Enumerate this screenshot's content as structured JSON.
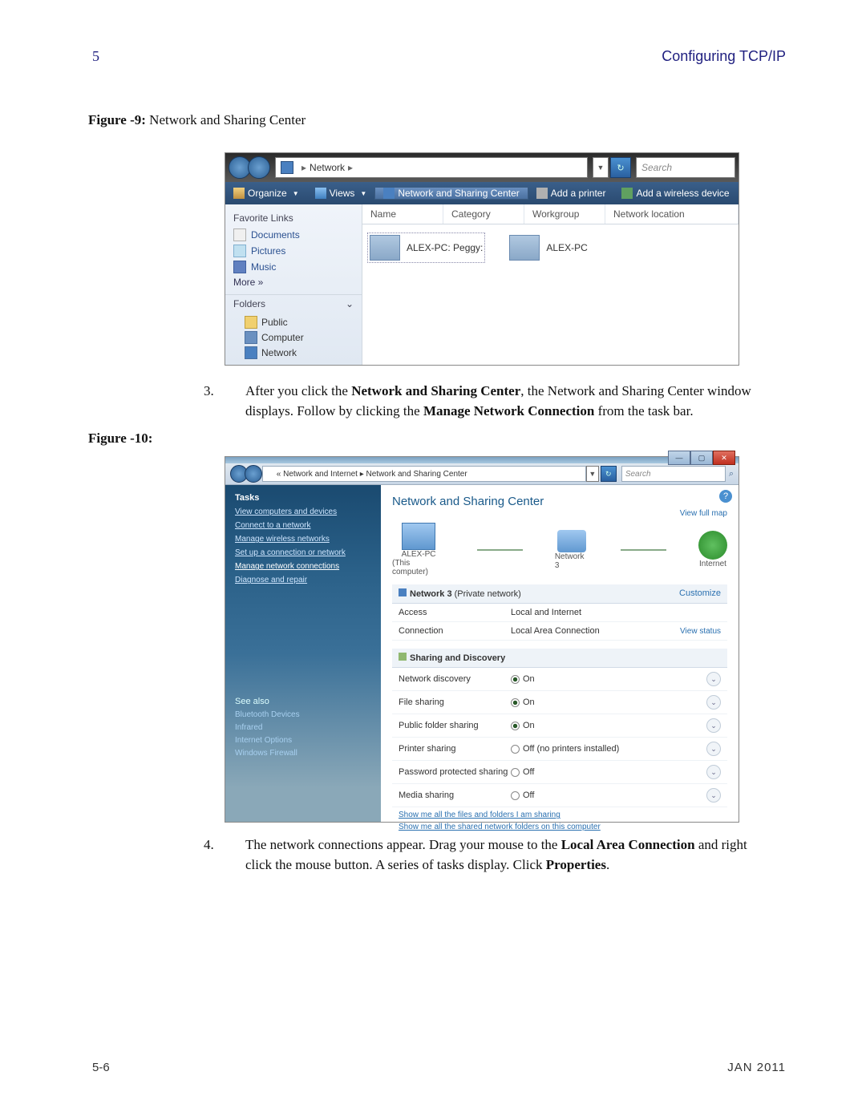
{
  "header": {
    "chapter_num": "5",
    "title": "Configuring TCP/IP"
  },
  "figure9_caption_bold": "Figure -9:",
  "figure9_caption_rest": " Network and Sharing Center",
  "figure5_9": {
    "breadcrumb": "Network",
    "breadcrumb_sep": "▸",
    "search_placeholder": "Search",
    "toolbar": {
      "organize": "Organize",
      "views": "Views",
      "nsc": "Network and Sharing Center",
      "add_printer": "Add a printer",
      "add_wireless": "Add a wireless device"
    },
    "sidebar": {
      "fav_heading": "Favorite Links",
      "documents": "Documents",
      "pictures": "Pictures",
      "music": "Music",
      "more": "More  »",
      "folders_header": "Folders",
      "public": "Public",
      "computer": "Computer",
      "network": "Network"
    },
    "columns": {
      "name": "Name",
      "category": "Category",
      "workgroup": "Workgroup",
      "location": "Network location"
    },
    "items": {
      "item1": "ALEX-PC: Peggy:",
      "item2": "ALEX-PC"
    }
  },
  "step3": {
    "num": "3.",
    "text_a": "After you click the ",
    "bold_a": "Network and Sharing Center",
    "text_b": ", the Network and Sharing Center window displays. Follow by clicking the ",
    "bold_b": "Manage Network Connection",
    "text_c": " from the task bar."
  },
  "figure10_caption": "Figure -10:",
  "figure5_10": {
    "breadcrumb": "« Network and Internet  ▸  Network and Sharing Center",
    "search_placeholder": "Search",
    "tasks_header": "Tasks",
    "tasks": {
      "t1": "View computers and devices",
      "t2": "Connect to a network",
      "t3": "Manage wireless networks",
      "t4": "Set up a connection or network",
      "t5": "Manage network connections",
      "t6": "Diagnose and repair"
    },
    "see_also_header": "See also",
    "see_also": {
      "s1": "Bluetooth Devices",
      "s2": "Infrared",
      "s3": "Internet Options",
      "s4": "Windows Firewall"
    },
    "title": "Network and Sharing Center",
    "view_full_map": "View full map",
    "nodes": {
      "pc": "ALEX-PC",
      "pc_sub": "(This computer)",
      "net": "Network 3",
      "internet": "Internet"
    },
    "net_section": {
      "name_bold": "Network 3",
      "name_paren": " (Private network)",
      "customize": "Customize"
    },
    "rows": {
      "access_k": "Access",
      "access_v": "Local and Internet",
      "conn_k": "Connection",
      "conn_v": "Local Area Connection",
      "view_status": "View status"
    },
    "sharing_header": "Sharing and Discovery",
    "sharing": {
      "nd_k": "Network discovery",
      "nd_v": "On",
      "fs_k": "File sharing",
      "fs_v": "On",
      "pf_k": "Public folder sharing",
      "pf_v": "On",
      "ps_k": "Printer sharing",
      "ps_v": "Off (no printers installed)",
      "pp_k": "Password protected sharing",
      "pp_v": "Off",
      "ms_k": "Media sharing",
      "ms_v": "Off"
    },
    "show_links": {
      "l1": "Show me all the files and folders I am sharing",
      "l2": "Show me all the shared network folders on this computer"
    }
  },
  "step4": {
    "num": "4.",
    "text_a": "The network connections appear. Drag your mouse to the ",
    "bold_a": "Local Area Connection",
    "text_b": " and right click the mouse button. A series of tasks display. Click ",
    "bold_b": "Properties",
    "text_c": "."
  },
  "footer": {
    "page": "5-6",
    "date": "JAN 2011"
  }
}
